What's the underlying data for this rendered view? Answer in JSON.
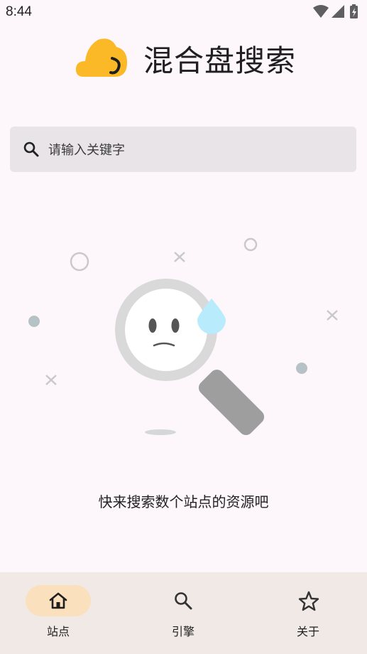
{
  "status_bar": {
    "time": "8:44",
    "icons": [
      "wifi-icon",
      "signal-icon",
      "battery-charging-icon"
    ]
  },
  "header": {
    "title": "混合盘搜索",
    "logo_color": "#fbb928"
  },
  "search": {
    "placeholder": "请输入关键字",
    "value": ""
  },
  "empty_state": {
    "message": "快来搜索数个站点的资源吧",
    "illustration": "sad-magnifier-illustration"
  },
  "bottom_nav": {
    "items": [
      {
        "label": "站点",
        "icon": "home-icon",
        "active": true
      },
      {
        "label": "引擎",
        "icon": "search-icon",
        "active": false
      },
      {
        "label": "关于",
        "icon": "star-icon",
        "active": false
      }
    ]
  },
  "colors": {
    "background": "#fdf7fb",
    "search_bg": "#e8e4e7",
    "nav_bg": "#f1e9e6",
    "nav_active": "#fbe0be",
    "accent": "#fbb928"
  }
}
